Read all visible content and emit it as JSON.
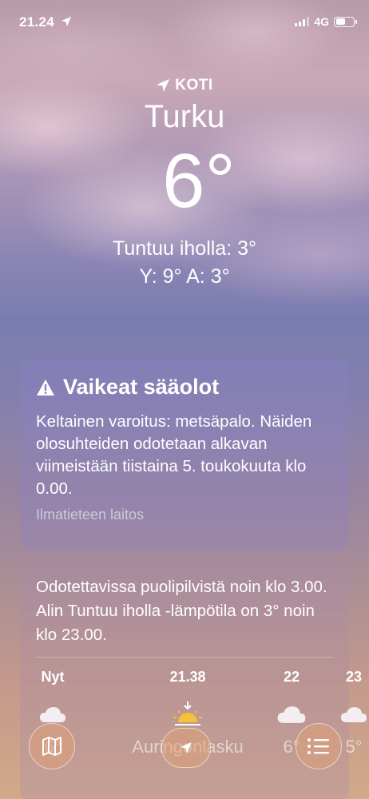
{
  "status_bar": {
    "time": "21.24",
    "network": "4G"
  },
  "header": {
    "home_label": "KOTI",
    "city": "Turku",
    "temperature": "6°",
    "feels_like": "Tuntuu iholla: 3°",
    "high_low": "Y:  9° A: 3°"
  },
  "alert": {
    "title": "Vaikeat sääolot",
    "text": "Keltainen varoitus: metsäpalo. Näiden olosuhteiden odotetaan alkavan viimeistään tiistaina 5. toukokuuta klo 0.00.",
    "source": "Ilmatieteen laitos"
  },
  "forecast": {
    "summary": "Odotettavissa puolipilvistä noin klo 3.00. Alin Tuntuu iholla -lämpötila on 3° noin klo 23.00.",
    "hours": [
      {
        "label": "Nyt",
        "icon": "cloud-icon",
        "value": "6°"
      },
      {
        "label": "21.38",
        "icon": "sunset-icon",
        "value": "Auringonlasku"
      },
      {
        "label": "22",
        "icon": "cloud-icon",
        "value": "6°"
      },
      {
        "label": "23",
        "icon": "cloud-icon",
        "value": "5°"
      }
    ]
  },
  "toolbar": {
    "map_icon": "map-icon",
    "location_icon": "location-arrow-icon",
    "list_icon": "list-icon"
  },
  "colors": {
    "accent": "#ffffff",
    "alert_card": "#8c82c3",
    "toolbar_button": "#dca078"
  }
}
